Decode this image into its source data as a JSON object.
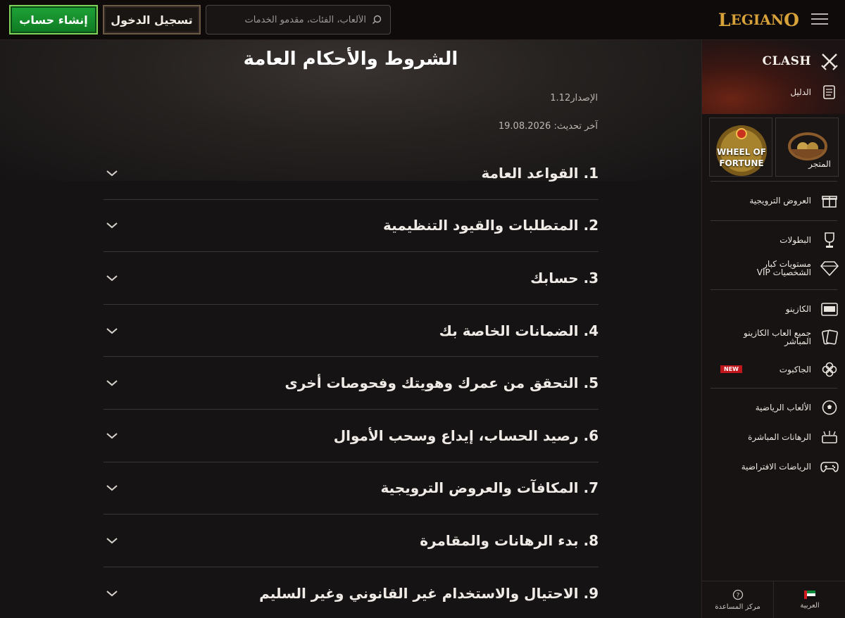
{
  "header": {
    "register_label": "إنشاء حساب",
    "login_label": "تسجيل الدخول",
    "search_placeholder": "الألعاب، الفئات، مقدمو الخدمات",
    "logo_text_big": "L",
    "logo_text_mid": "EGIAN",
    "logo_text_end": "O"
  },
  "page": {
    "title": "الشروط والأحكام العامة",
    "version": "الإصدار1.12",
    "updated": "آخر تحديث: 19.08.2026"
  },
  "sections": [
    "1. القواعد العامة",
    "2. المتطلبات والقيود التنظيمية",
    "3. حسابك",
    "4. الضمانات الخاصة بك",
    "5. التحقق من عمرك وهويتك وفحوصات أخرى",
    "6. رصيد الحساب، إيداع وسحب الأموال",
    "7. المكافآت والعروض الترويجية",
    "8. بدء الرهانات والمقامرة",
    "9. الاحتيال والاستخدام غير القانوني وغير السليم"
  ],
  "sidebar": {
    "clash": "CLASH",
    "guide": "الدليل",
    "shop": "المتجر",
    "wheel_line1": "WHEEL OF",
    "wheel_line2": "FORTUNE",
    "promotions": "العروض الترويجية",
    "tournaments": "البطولات",
    "vip_line1": "مستويات كبار",
    "vip_line2": "الشخصيات VIP",
    "casino": "الكازينو",
    "live_line1": "جميع العاب الكازينو",
    "live_line2": "المباشر",
    "jackpot": "الجاكبوت",
    "new_badge": "NEW",
    "sports": "الألعاب الرياضية",
    "live_bets": "الرهانات المباشرة",
    "virtual": "الرياضات الافتراضية",
    "help": "مركز المساعدة",
    "language": "العربية"
  },
  "colors": {
    "register_green": "#1fa238",
    "logo_gold": "#d8a23a",
    "background": "#151314",
    "new_red": "#c0161c"
  },
  "icons": [
    "search-icon",
    "menu-icon",
    "chevron-down-icon",
    "swords-icon",
    "scroll-icon",
    "gift-icon",
    "trophy-icon",
    "diamond-icon",
    "slot-machine-icon",
    "cards-icon",
    "clover-icon",
    "ball-icon",
    "live-icon",
    "gamepad-icon",
    "help-icon",
    "flag-icon"
  ]
}
